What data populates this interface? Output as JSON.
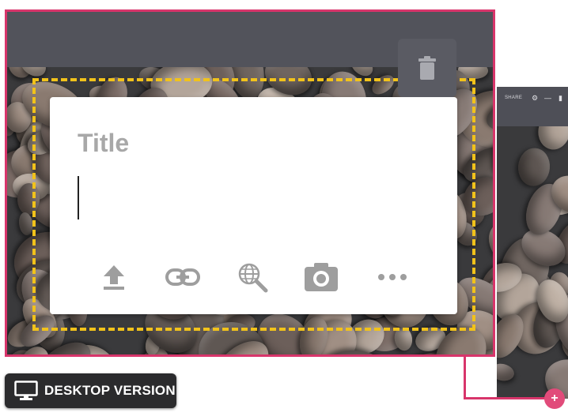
{
  "card": {
    "title_placeholder": "Title",
    "tools": [
      {
        "icon": "upload-icon"
      },
      {
        "icon": "link-icon"
      },
      {
        "icon": "web-search-icon"
      },
      {
        "icon": "camera-icon"
      },
      {
        "icon": "more-icon"
      }
    ]
  },
  "toolbar": {
    "delete_icon": "trash-icon"
  },
  "side_preview": {
    "share_label": "SHARE"
  },
  "badge": {
    "label": "DESKTOP VERSION",
    "icon": "monitor-icon"
  },
  "colors": {
    "frame": "#d8356b",
    "dashed_outline": "#f1c21b",
    "topbar": "#52535b",
    "icon_gray": "#9e9e9e"
  }
}
